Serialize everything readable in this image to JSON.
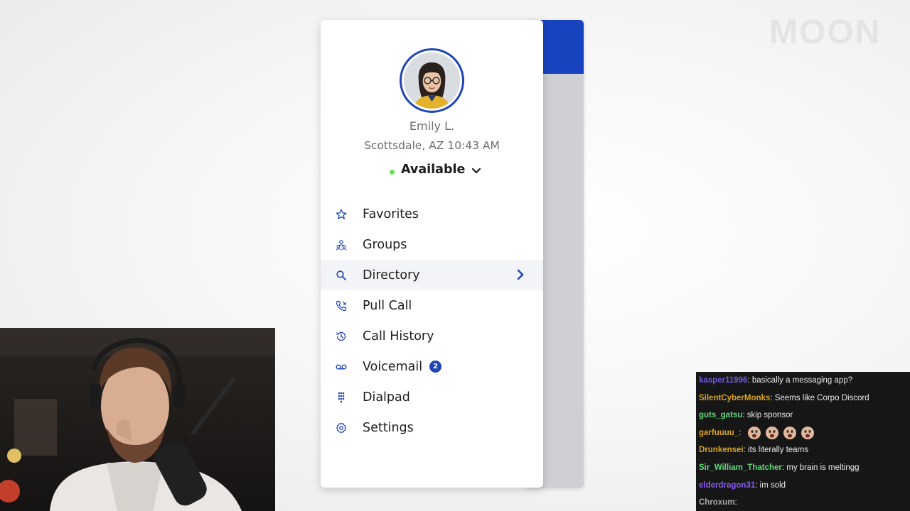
{
  "watermark": "MOON",
  "profile": {
    "name": "Emily L.",
    "location": "Scottsdale, AZ 10:43 AM",
    "status": "Available",
    "status_color": "#6edb5b",
    "accent_color": "#1f44b5"
  },
  "menu": [
    {
      "label": "Favorites",
      "icon": "star-icon"
    },
    {
      "label": "Groups",
      "icon": "groups-icon"
    },
    {
      "label": "Directory",
      "icon": "search-icon",
      "active": true
    },
    {
      "label": "Pull Call",
      "icon": "phone-icon"
    },
    {
      "label": "Call History",
      "icon": "history-icon"
    },
    {
      "label": "Voicemail",
      "icon": "voicemail-icon",
      "badge": "2"
    },
    {
      "label": "Dialpad",
      "icon": "dialpad-icon"
    },
    {
      "label": "Settings",
      "icon": "gear-icon"
    }
  ],
  "chat": [
    {
      "user": "kasper11996",
      "color": "#6b5ce7",
      "message": "basically a messaging app?"
    },
    {
      "user": "SilentCyberMonks",
      "color": "#daa520",
      "message": "Seems like Corpo Discord"
    },
    {
      "user": "guts_gatsu",
      "color": "#5fd97a",
      "message": "skip sponsor"
    },
    {
      "user": "garfuuuu_",
      "color": "#daa520",
      "message": "",
      "emotes": 4
    },
    {
      "user": "Drunkensei",
      "color": "#daa520",
      "message": "its literally teams"
    },
    {
      "user": "Sir_William_Thatcher",
      "color": "#5fd97a",
      "message": "my brain is meltingg"
    },
    {
      "user": "elderdragon31",
      "color": "#8a5cf0",
      "message": "im sold"
    },
    {
      "user": "Chroxum",
      "color": "#aaaaaa",
      "message": ""
    }
  ]
}
